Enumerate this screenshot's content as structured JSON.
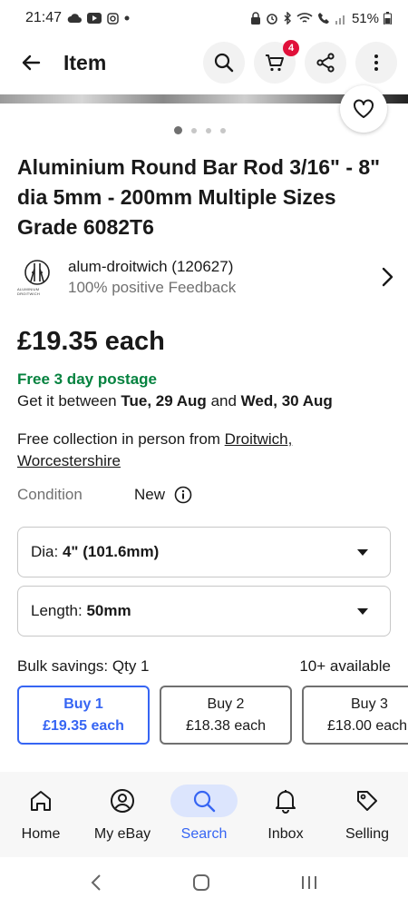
{
  "status_bar": {
    "time": "21:47",
    "battery": "51%"
  },
  "app_bar": {
    "title": "Item",
    "cart_count": "4",
    "icons": [
      "back-arrow-icon",
      "search-icon",
      "cart-icon",
      "share-icon",
      "more-vertical-icon"
    ]
  },
  "gallery": {
    "page_count": 4,
    "active_page": 1
  },
  "listing": {
    "title": "Aluminium Round Bar Rod 3/16\" - 8\" dia 5mm - 200mm Multiple Sizes Grade 6082T6",
    "seller_name": "alum-droitwich (120627)",
    "seller_feedback": "100% positive Feedback",
    "seller_logo_caption": "ALUMINIUM DROITWICH",
    "price": "£19.35 each",
    "postage": "Free 3 day postage",
    "delivery_prefix": "Get it between",
    "delivery_start": "Tue, 29 Aug",
    "delivery_and": "and",
    "delivery_end": "Wed, 30 Aug",
    "collection_prefix": "Free collection in person from",
    "collection_link": "Droitwich, Worcestershire",
    "condition_label": "Condition",
    "condition_value": "New"
  },
  "variations": [
    {
      "label": "Dia:",
      "value": "4\" (101.6mm)"
    },
    {
      "label": "Length:",
      "value": "50mm"
    }
  ],
  "bulk": {
    "label": "Bulk savings: Qty 1",
    "available": "10+ available",
    "options": [
      {
        "title": "Buy 1",
        "price": "£19.35 each",
        "selected": true
      },
      {
        "title": "Buy 2",
        "price": "£18.38 each",
        "selected": false
      },
      {
        "title": "Buy 3",
        "price": "£18.00 each",
        "selected": false
      }
    ]
  },
  "bottom_nav": {
    "items": [
      {
        "label": "Home",
        "icon": "home-icon"
      },
      {
        "label": "My eBay",
        "icon": "user-icon"
      },
      {
        "label": "Search",
        "icon": "search-icon",
        "active": true
      },
      {
        "label": "Inbox",
        "icon": "bell-icon"
      },
      {
        "label": "Selling",
        "icon": "tag-icon"
      }
    ]
  },
  "colors": {
    "accent": "#3665f3",
    "postage_green": "#05823f",
    "badge_red": "#e0103a"
  }
}
